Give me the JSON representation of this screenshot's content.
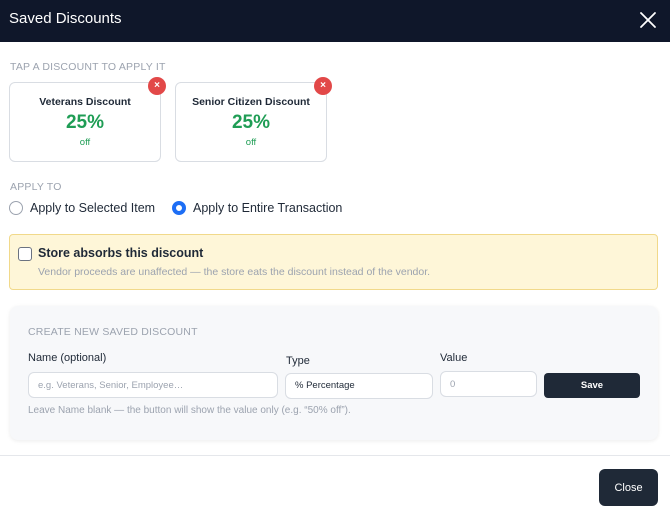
{
  "modal": {
    "title": "Saved Discounts",
    "tap_hint": "TAP A DISCOUNT TO APPLY IT",
    "remove_symbol": "×"
  },
  "discounts": [
    {
      "name": "Veterans Discount",
      "value": "25%",
      "suffix": "off"
    },
    {
      "name": "Senior Citizen Discount",
      "value": "25%",
      "suffix": "off"
    }
  ],
  "apply_to": {
    "label": "APPLY TO",
    "options": [
      {
        "label": "Apply to Selected Item",
        "checked": false
      },
      {
        "label": "Apply to Entire Transaction",
        "checked": true
      }
    ]
  },
  "absorb": {
    "title": "Store absorbs this discount",
    "description": "Vendor proceeds are unaffected — the store eats the discount instead of the vendor.",
    "checked": false
  },
  "create": {
    "heading": "CREATE NEW SAVED DISCOUNT",
    "name_label": "Name (optional)",
    "name_placeholder": "e.g. Veterans, Senior, Employee…",
    "type_label": "Type",
    "type_value": "% Percentage",
    "value_label": "Value",
    "value_placeholder": "0",
    "save_label": "Save",
    "hint": "Leave Name blank — the button will show the value only (e.g. “50% off”)."
  },
  "footer": {
    "close_label": "Close"
  },
  "colors": {
    "header_bg": "#0f172a",
    "accent_green": "#1f9d55",
    "remove_red": "#e24848",
    "radio_blue": "#1d6ef5",
    "absorb_bg": "#fef6d8",
    "dark_button": "#1f2937"
  }
}
